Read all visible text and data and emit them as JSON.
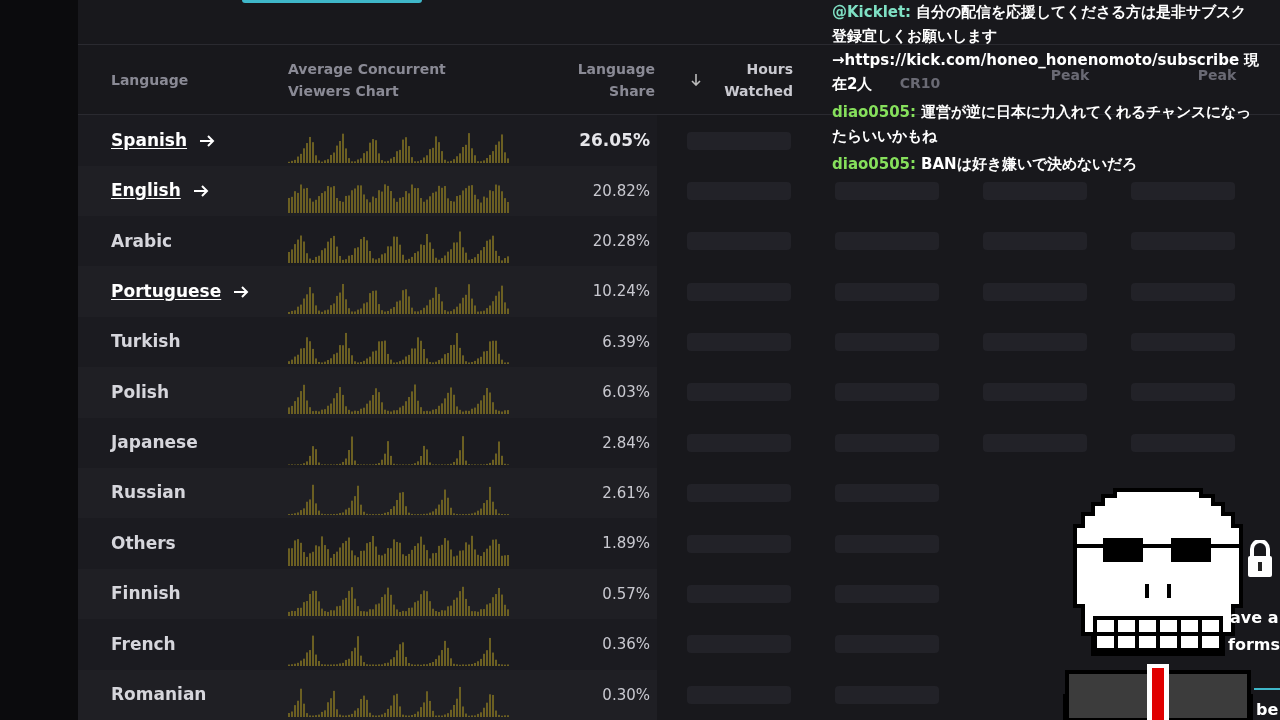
{
  "table": {
    "columns": [
      {
        "label": "Language",
        "sorted": false
      },
      {
        "label": "Average Concurrent Viewers Chart",
        "sorted": false
      },
      {
        "label": "Language Share",
        "sorted": false
      },
      {
        "label": "Hours Watched",
        "sorted": true
      }
    ],
    "faded_columns": [
      "CR10",
      "Peak",
      "Peak"
    ],
    "rows": [
      {
        "language": "Spanish",
        "link": true,
        "share": "26.05%",
        "emphasized": true
      },
      {
        "language": "English",
        "link": true,
        "share": "20.82%",
        "emphasized": false
      },
      {
        "language": "Arabic",
        "link": false,
        "share": "20.28%",
        "emphasized": false
      },
      {
        "language": "Portuguese",
        "link": true,
        "share": "10.24%",
        "emphasized": false
      },
      {
        "language": "Turkish",
        "link": false,
        "share": "6.39%",
        "emphasized": false
      },
      {
        "language": "Polish",
        "link": false,
        "share": "6.03%",
        "emphasized": false
      },
      {
        "language": "Japanese",
        "link": false,
        "share": "2.84%",
        "emphasized": false
      },
      {
        "language": "Russian",
        "link": false,
        "share": "2.61%",
        "emphasized": false
      },
      {
        "language": "Others",
        "link": false,
        "share": "1.89%",
        "emphasized": false
      },
      {
        "language": "Finnish",
        "link": false,
        "share": "0.57%",
        "emphasized": false
      },
      {
        "language": "French",
        "link": false,
        "share": "0.36%",
        "emphasized": false
      },
      {
        "language": "Romanian",
        "link": false,
        "share": "0.30%",
        "emphasized": false
      }
    ]
  },
  "chat": {
    "messages": [
      {
        "user": "@Kicklet:",
        "color": "#7fe0c4",
        "lines": [
          "自分の配信を応援してくださる方は是非サブスク",
          "登録宜しくお願いします",
          "→https://kick.com/honeo_honenomoto/subscribe 現",
          "在2人"
        ]
      },
      {
        "user": "diao0505:",
        "color": "#86e05c",
        "lines": [
          "運営が逆に日本に力入れてくれるチャンスになっ",
          "たらいいかもね"
        ]
      },
      {
        "user": "diao0505:",
        "color": "#86e05c",
        "lines": [
          "BANは好き嫌いで決めないだろ"
        ]
      }
    ]
  },
  "side_fragments": [
    "ave a",
    "forms",
    "be"
  ]
}
